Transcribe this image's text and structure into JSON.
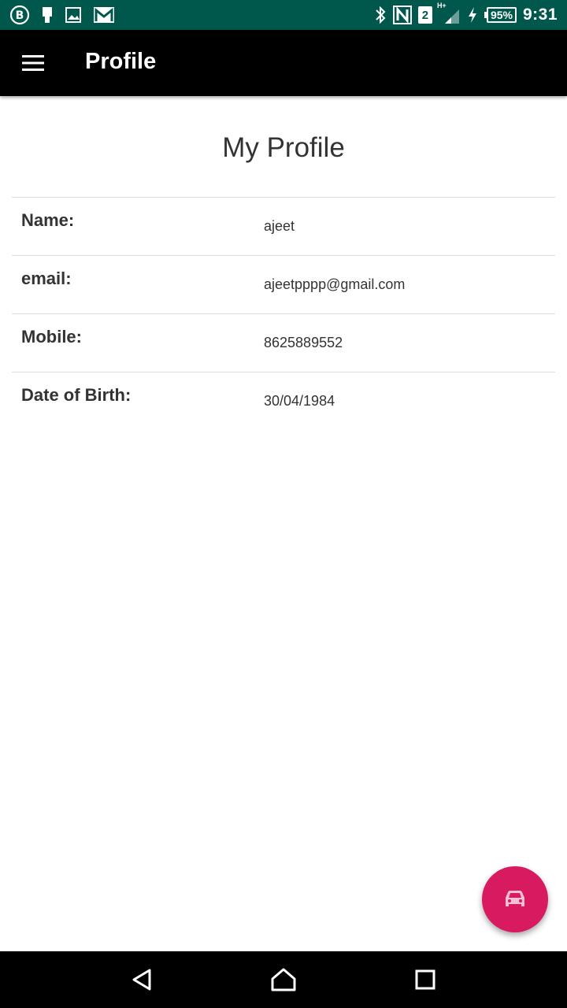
{
  "status_bar": {
    "left_icons": [
      "b-circle-icon",
      "phone-icon",
      "image-icon",
      "gmail-icon"
    ],
    "sim_number": "2",
    "network_type": "H+",
    "battery_percent": "95%",
    "time": "9:31",
    "background_color": "#00574b"
  },
  "app_bar": {
    "title": "Profile",
    "background_color": "#000000"
  },
  "page": {
    "heading": "My Profile"
  },
  "profile": {
    "rows": [
      {
        "label": "Name:",
        "value": "ajeet"
      },
      {
        "label": "email:",
        "value": "ajeetpppp@gmail.com"
      },
      {
        "label": "Mobile:",
        "value": "8625889552"
      },
      {
        "label": "Date of Birth:",
        "value": "30/04/1984"
      }
    ]
  },
  "fab": {
    "icon": "car-icon",
    "color": "#d81b60"
  },
  "nav_bar": {
    "buttons": [
      "back-icon",
      "home-icon",
      "recents-icon"
    ]
  }
}
